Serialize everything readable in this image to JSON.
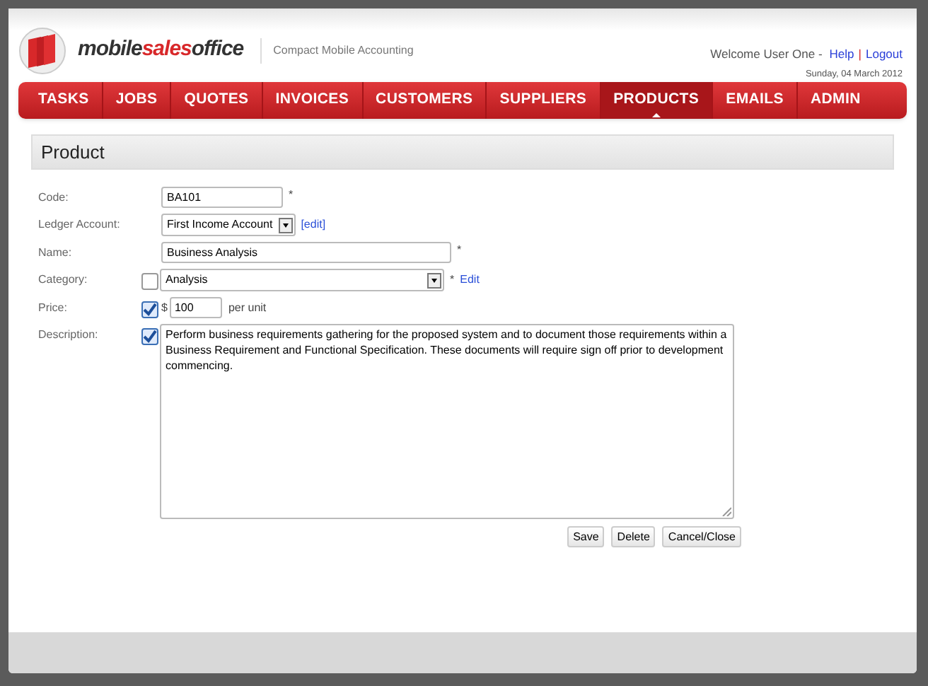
{
  "logo": {
    "part_1": "mobile",
    "part_2": "sales",
    "part_3": "office"
  },
  "tagline": "Compact Mobile Accounting",
  "user": {
    "welcome": "Welcome User One -",
    "links": [
      "Help",
      "Logout"
    ],
    "separator": "|",
    "date": "Sunday, 04 March 2012"
  },
  "nav": [
    {
      "label": "TASKS",
      "selected": false
    },
    {
      "label": "JOBS",
      "selected": false
    },
    {
      "label": "QUOTES",
      "selected": false
    },
    {
      "label": "INVOICES",
      "selected": false
    },
    {
      "label": "CUSTOMERS",
      "selected": false
    },
    {
      "label": "SUPPLIERS",
      "selected": false
    },
    {
      "label": "PRODUCTS",
      "selected": true
    },
    {
      "label": "EMAILS",
      "selected": false
    },
    {
      "label": "ADMIN",
      "selected": false
    }
  ],
  "page_title": "Product",
  "fields": [
    {
      "kind": "text",
      "label": "Code:",
      "value": "BA101",
      "required": "*"
    },
    {
      "kind": "select",
      "label": "Ledger Account:",
      "value": "First Income Account",
      "link": "[edit]"
    },
    {
      "kind": "text",
      "label": "Name:",
      "value": "Business Analysis",
      "required": "*"
    },
    {
      "kind": "select",
      "label": "Category:",
      "checked": false,
      "value": "Analysis",
      "required": "*",
      "link": "Edit"
    },
    {
      "kind": "price",
      "label": "Price:",
      "checked": true,
      "currency": "$",
      "value": "100",
      "unit": "per unit"
    },
    {
      "kind": "textarea",
      "label": "Description:",
      "checked": true,
      "value": "Perform business requirements gathering for the proposed system and to document those requirements within a Business Requirement and Functional Specification. These documents will require sign off prior to development commencing."
    }
  ],
  "buttons": [
    "Save",
    "Delete",
    "Cancel/Close"
  ]
}
